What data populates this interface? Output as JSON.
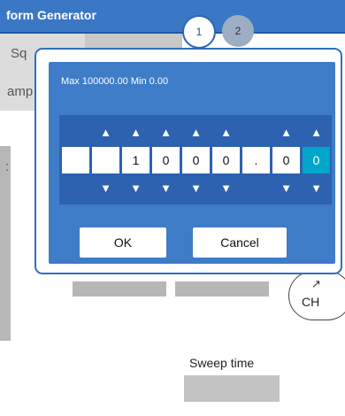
{
  "app": {
    "title": "form Generator"
  },
  "steps": [
    "1",
    "2"
  ],
  "background": {
    "tab_a_label": "Sq",
    "tab_b_label": "amp",
    "colon": ":",
    "sweep_time_label": "Sweep time",
    "ch_label": "CH",
    "ch_arrow": "↗"
  },
  "dialog": {
    "range_text": "Max 100000.00   Min 0.00",
    "up_arrow": "▲",
    "down_arrow": "▼",
    "digits": [
      "",
      "",
      "1",
      "0",
      "0",
      "0",
      ".",
      "0",
      "0"
    ],
    "active_index": 8,
    "ok_label": "OK",
    "cancel_label": "Cancel"
  },
  "colors": {
    "panel": "#3f7cc8",
    "band": "#2c62b0",
    "active_digit": "#00a6c9",
    "title_bar": "#3a78c6"
  }
}
